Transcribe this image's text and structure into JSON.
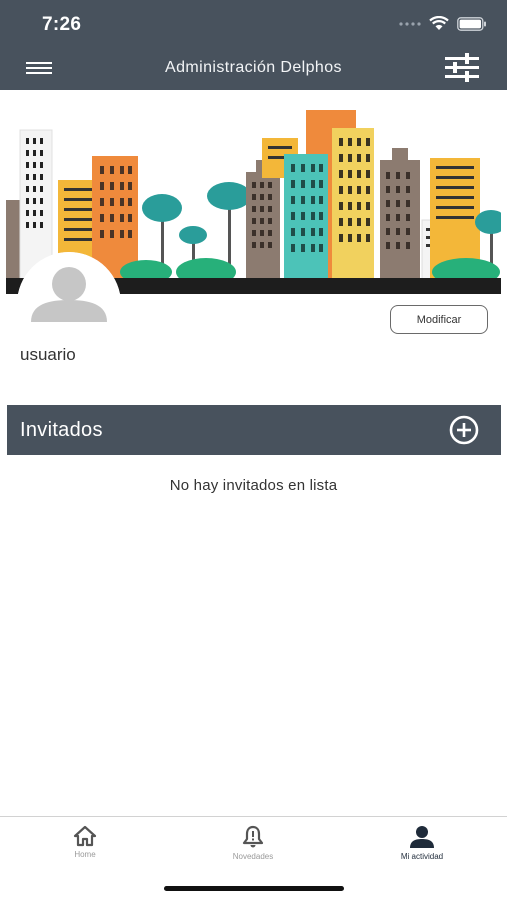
{
  "status_bar": {
    "time": "7:26"
  },
  "header": {
    "title": "Administración Delphos",
    "menu_icon": "hamburger-menu-icon",
    "filter_icon": "sliders-icon"
  },
  "profile": {
    "username": "usuario",
    "modify_label": "Modificar"
  },
  "guests": {
    "title": "Invitados",
    "add_icon": "plus-circle-icon",
    "empty_message": "No hay invitados en lista"
  },
  "tabs": [
    {
      "label": "Home",
      "icon": "home-icon",
      "active": false
    },
    {
      "label": "Novedades",
      "icon": "bell-alert-icon",
      "active": false
    },
    {
      "label": "Mi actividad",
      "icon": "person-icon",
      "active": true
    }
  ],
  "colors": {
    "header_bg": "#48525d",
    "active_tab": "#1f2b3a",
    "inactive_tab": "#9a9a9a"
  }
}
